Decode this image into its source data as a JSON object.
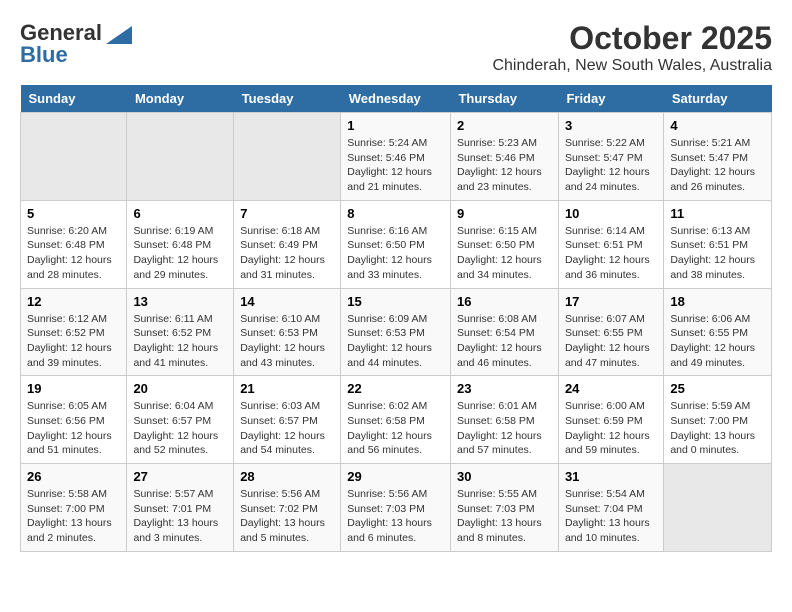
{
  "logo": {
    "general": "General",
    "blue": "Blue"
  },
  "title": "October 2025",
  "subtitle": "Chinderah, New South Wales, Australia",
  "weekdays": [
    "Sunday",
    "Monday",
    "Tuesday",
    "Wednesday",
    "Thursday",
    "Friday",
    "Saturday"
  ],
  "weeks": [
    [
      {
        "day": "",
        "info": ""
      },
      {
        "day": "",
        "info": ""
      },
      {
        "day": "",
        "info": ""
      },
      {
        "day": "1",
        "info": "Sunrise: 5:24 AM\nSunset: 5:46 PM\nDaylight: 12 hours\nand 21 minutes."
      },
      {
        "day": "2",
        "info": "Sunrise: 5:23 AM\nSunset: 5:46 PM\nDaylight: 12 hours\nand 23 minutes."
      },
      {
        "day": "3",
        "info": "Sunrise: 5:22 AM\nSunset: 5:47 PM\nDaylight: 12 hours\nand 24 minutes."
      },
      {
        "day": "4",
        "info": "Sunrise: 5:21 AM\nSunset: 5:47 PM\nDaylight: 12 hours\nand 26 minutes."
      }
    ],
    [
      {
        "day": "5",
        "info": "Sunrise: 6:20 AM\nSunset: 6:48 PM\nDaylight: 12 hours\nand 28 minutes."
      },
      {
        "day": "6",
        "info": "Sunrise: 6:19 AM\nSunset: 6:48 PM\nDaylight: 12 hours\nand 29 minutes."
      },
      {
        "day": "7",
        "info": "Sunrise: 6:18 AM\nSunset: 6:49 PM\nDaylight: 12 hours\nand 31 minutes."
      },
      {
        "day": "8",
        "info": "Sunrise: 6:16 AM\nSunset: 6:50 PM\nDaylight: 12 hours\nand 33 minutes."
      },
      {
        "day": "9",
        "info": "Sunrise: 6:15 AM\nSunset: 6:50 PM\nDaylight: 12 hours\nand 34 minutes."
      },
      {
        "day": "10",
        "info": "Sunrise: 6:14 AM\nSunset: 6:51 PM\nDaylight: 12 hours\nand 36 minutes."
      },
      {
        "day": "11",
        "info": "Sunrise: 6:13 AM\nSunset: 6:51 PM\nDaylight: 12 hours\nand 38 minutes."
      }
    ],
    [
      {
        "day": "12",
        "info": "Sunrise: 6:12 AM\nSunset: 6:52 PM\nDaylight: 12 hours\nand 39 minutes."
      },
      {
        "day": "13",
        "info": "Sunrise: 6:11 AM\nSunset: 6:52 PM\nDaylight: 12 hours\nand 41 minutes."
      },
      {
        "day": "14",
        "info": "Sunrise: 6:10 AM\nSunset: 6:53 PM\nDaylight: 12 hours\nand 43 minutes."
      },
      {
        "day": "15",
        "info": "Sunrise: 6:09 AM\nSunset: 6:53 PM\nDaylight: 12 hours\nand 44 minutes."
      },
      {
        "day": "16",
        "info": "Sunrise: 6:08 AM\nSunset: 6:54 PM\nDaylight: 12 hours\nand 46 minutes."
      },
      {
        "day": "17",
        "info": "Sunrise: 6:07 AM\nSunset: 6:55 PM\nDaylight: 12 hours\nand 47 minutes."
      },
      {
        "day": "18",
        "info": "Sunrise: 6:06 AM\nSunset: 6:55 PM\nDaylight: 12 hours\nand 49 minutes."
      }
    ],
    [
      {
        "day": "19",
        "info": "Sunrise: 6:05 AM\nSunset: 6:56 PM\nDaylight: 12 hours\nand 51 minutes."
      },
      {
        "day": "20",
        "info": "Sunrise: 6:04 AM\nSunset: 6:57 PM\nDaylight: 12 hours\nand 52 minutes."
      },
      {
        "day": "21",
        "info": "Sunrise: 6:03 AM\nSunset: 6:57 PM\nDaylight: 12 hours\nand 54 minutes."
      },
      {
        "day": "22",
        "info": "Sunrise: 6:02 AM\nSunset: 6:58 PM\nDaylight: 12 hours\nand 56 minutes."
      },
      {
        "day": "23",
        "info": "Sunrise: 6:01 AM\nSunset: 6:58 PM\nDaylight: 12 hours\nand 57 minutes."
      },
      {
        "day": "24",
        "info": "Sunrise: 6:00 AM\nSunset: 6:59 PM\nDaylight: 12 hours\nand 59 minutes."
      },
      {
        "day": "25",
        "info": "Sunrise: 5:59 AM\nSunset: 7:00 PM\nDaylight: 13 hours\nand 0 minutes."
      }
    ],
    [
      {
        "day": "26",
        "info": "Sunrise: 5:58 AM\nSunset: 7:00 PM\nDaylight: 13 hours\nand 2 minutes."
      },
      {
        "day": "27",
        "info": "Sunrise: 5:57 AM\nSunset: 7:01 PM\nDaylight: 13 hours\nand 3 minutes."
      },
      {
        "day": "28",
        "info": "Sunrise: 5:56 AM\nSunset: 7:02 PM\nDaylight: 13 hours\nand 5 minutes."
      },
      {
        "day": "29",
        "info": "Sunrise: 5:56 AM\nSunset: 7:03 PM\nDaylight: 13 hours\nand 6 minutes."
      },
      {
        "day": "30",
        "info": "Sunrise: 5:55 AM\nSunset: 7:03 PM\nDaylight: 13 hours\nand 8 minutes."
      },
      {
        "day": "31",
        "info": "Sunrise: 5:54 AM\nSunset: 7:04 PM\nDaylight: 13 hours\nand 10 minutes."
      },
      {
        "day": "",
        "info": ""
      }
    ]
  ]
}
